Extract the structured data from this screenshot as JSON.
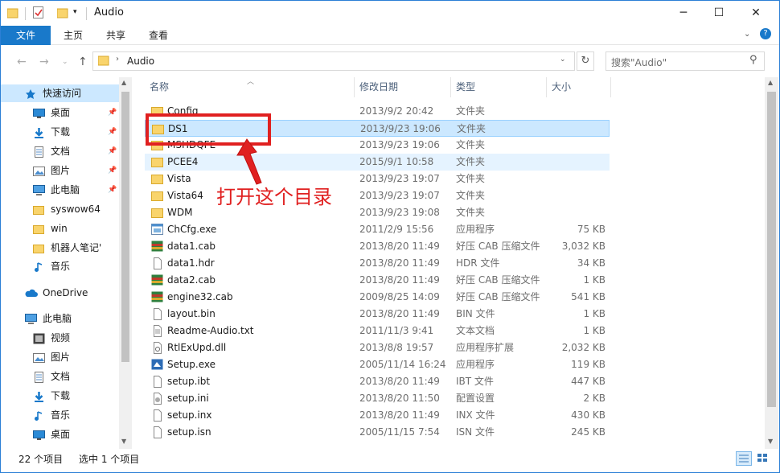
{
  "window": {
    "title": "Audio"
  },
  "ribbon": {
    "tabs": [
      "文件",
      "主页",
      "共享",
      "查看"
    ]
  },
  "address": {
    "path": "Audio",
    "search_placeholder": "搜索\"Audio\""
  },
  "nav": {
    "items": [
      {
        "label": "快速访问",
        "icon": "star-icon"
      },
      {
        "label": "桌面",
        "icon": "desktop-icon"
      },
      {
        "label": "下载",
        "icon": "download-icon"
      },
      {
        "label": "文档",
        "icon": "document-icon"
      },
      {
        "label": "图片",
        "icon": "picture-icon"
      },
      {
        "label": "此电脑",
        "icon": "computer-icon"
      },
      {
        "label": "syswow64",
        "icon": "folder-icon"
      },
      {
        "label": "win",
        "icon": "folder-icon"
      },
      {
        "label": "机器人笔记'",
        "icon": "folder-icon"
      },
      {
        "label": "音乐",
        "icon": "music-icon"
      },
      {
        "label": "OneDrive",
        "icon": "cloud-icon"
      },
      {
        "label": "此电脑",
        "icon": "computer-icon"
      },
      {
        "label": "视频",
        "icon": "video-icon"
      },
      {
        "label": "图片",
        "icon": "picture-icon"
      },
      {
        "label": "文档",
        "icon": "document-icon"
      },
      {
        "label": "下载",
        "icon": "download-icon"
      },
      {
        "label": "音乐",
        "icon": "music-icon"
      },
      {
        "label": "桌面",
        "icon": "desktop-icon"
      }
    ]
  },
  "list": {
    "headers": {
      "name": "名称",
      "date": "修改日期",
      "type": "类型",
      "size": "大小"
    },
    "rows": [
      {
        "name": "Config",
        "date": "2013/9/2 20:42",
        "type": "文件夹",
        "size": "",
        "icon": "folder-icon"
      },
      {
        "name": "DS1",
        "date": "2013/9/23 19:06",
        "type": "文件夹",
        "size": "",
        "icon": "folder-icon"
      },
      {
        "name": "MSHDQFE",
        "date": "2013/9/23 19:06",
        "type": "文件夹",
        "size": "",
        "icon": "folder-icon"
      },
      {
        "name": "PCEE4",
        "date": "2015/9/1 10:58",
        "type": "文件夹",
        "size": "",
        "icon": "folder-icon"
      },
      {
        "name": "Vista",
        "date": "2013/9/23 19:07",
        "type": "文件夹",
        "size": "",
        "icon": "folder-icon"
      },
      {
        "name": "Vista64",
        "date": "2013/9/23 19:07",
        "type": "文件夹",
        "size": "",
        "icon": "folder-icon"
      },
      {
        "name": "WDM",
        "date": "2013/9/23 19:08",
        "type": "文件夹",
        "size": "",
        "icon": "folder-icon"
      },
      {
        "name": "ChCfg.exe",
        "date": "2011/2/9 15:56",
        "type": "应用程序",
        "size": "75 KB",
        "icon": "exe-icon"
      },
      {
        "name": "data1.cab",
        "date": "2013/8/20 11:49",
        "type": "好压 CAB 压缩文件",
        "size": "3,032 KB",
        "icon": "archive-icon"
      },
      {
        "name": "data1.hdr",
        "date": "2013/8/20 11:49",
        "type": "HDR 文件",
        "size": "34 KB",
        "icon": "file-icon"
      },
      {
        "name": "data2.cab",
        "date": "2013/8/20 11:49",
        "type": "好压 CAB 压缩文件",
        "size": "1 KB",
        "icon": "archive-icon"
      },
      {
        "name": "engine32.cab",
        "date": "2009/8/25 14:09",
        "type": "好压 CAB 压缩文件",
        "size": "541 KB",
        "icon": "archive-icon"
      },
      {
        "name": "layout.bin",
        "date": "2013/8/20 11:49",
        "type": "BIN 文件",
        "size": "1 KB",
        "icon": "file-icon"
      },
      {
        "name": "Readme-Audio.txt",
        "date": "2011/11/3 9:41",
        "type": "文本文档",
        "size": "1 KB",
        "icon": "text-file-icon"
      },
      {
        "name": "RtlExUpd.dll",
        "date": "2013/8/8 19:57",
        "type": "应用程序扩展",
        "size": "2,032 KB",
        "icon": "dll-icon"
      },
      {
        "name": "Setup.exe",
        "date": "2005/11/14 16:24",
        "type": "应用程序",
        "size": "119 KB",
        "icon": "setup-icon"
      },
      {
        "name": "setup.ibt",
        "date": "2013/8/20 11:49",
        "type": "IBT 文件",
        "size": "447 KB",
        "icon": "file-icon"
      },
      {
        "name": "setup.ini",
        "date": "2013/8/20 11:50",
        "type": "配置设置",
        "size": "2 KB",
        "icon": "ini-icon"
      },
      {
        "name": "setup.inx",
        "date": "2013/8/20 11:49",
        "type": "INX 文件",
        "size": "430 KB",
        "icon": "file-icon"
      },
      {
        "name": "setup.isn",
        "date": "2005/11/15 7:54",
        "type": "ISN 文件",
        "size": "245 KB",
        "icon": "file-icon"
      }
    ]
  },
  "status": {
    "count": "22 个项目",
    "selected": "选中 1 个项目"
  },
  "annotation": {
    "text": "打开这个目录"
  },
  "colors": {
    "accent": "#1979ca",
    "selection": "#cce8ff",
    "annotation": "#e02020"
  }
}
